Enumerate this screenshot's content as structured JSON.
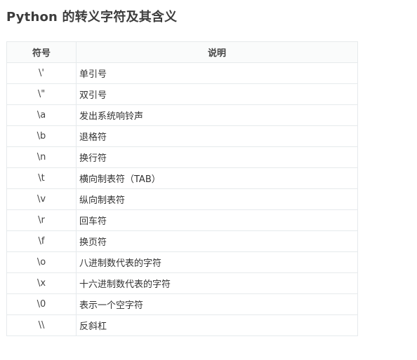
{
  "title": "Python 的转义字符及其含义",
  "table": {
    "headers": [
      "符号",
      "说明"
    ],
    "rows": [
      {
        "symbol": "\\'",
        "meaning": "单引号"
      },
      {
        "symbol": "\\\"",
        "meaning": "双引号"
      },
      {
        "symbol": "\\a",
        "meaning": "发出系统响铃声"
      },
      {
        "symbol": "\\b",
        "meaning": "退格符"
      },
      {
        "symbol": "\\n",
        "meaning": "换行符"
      },
      {
        "symbol": "\\t",
        "meaning": "横向制表符（TAB）"
      },
      {
        "symbol": "\\v",
        "meaning": "纵向制表符"
      },
      {
        "symbol": "\\r",
        "meaning": "回车符"
      },
      {
        "symbol": "\\f",
        "meaning": "换页符"
      },
      {
        "symbol": "\\o",
        "meaning": "八进制数代表的字符"
      },
      {
        "symbol": "\\x",
        "meaning": "十六进制数代表的字符"
      },
      {
        "symbol": "\\0",
        "meaning": "表示一个空字符"
      },
      {
        "symbol": "\\\\",
        "meaning": "反斜杠"
      }
    ]
  }
}
